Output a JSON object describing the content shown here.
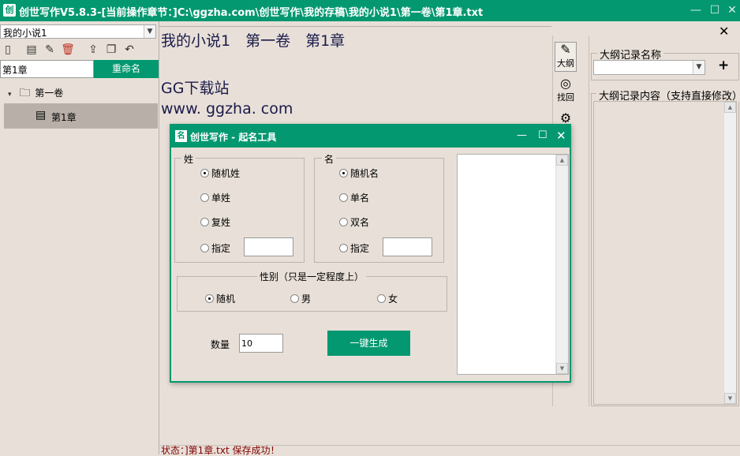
{
  "window": {
    "title": "创世写作V5.8.3-[当前操作章节：]C:\\ggzha.com\\创世写作\\我的存稿\\我的小说1\\第一卷\\第1章.txt",
    "icon_text": "创",
    "minimize": "—",
    "maximize": "☐",
    "close": "✕"
  },
  "sidebar": {
    "novel_select": "我的小说1",
    "rename_input": "第1章",
    "rename_button": "重命名",
    "tree": [
      {
        "label": "第一卷",
        "expanded": true
      },
      {
        "label": "第1章",
        "selected": true
      }
    ],
    "toolbar_icons": [
      "new-book-icon",
      "new-volume-icon",
      "edit-icon",
      "delete-icon",
      "export-icon",
      "copy-icon",
      "undo-icon"
    ]
  },
  "editor": {
    "lines": [
      "我的小说1　第一卷　第1章",
      "",
      "GG下载站",
      "www. ggzha. com"
    ]
  },
  "right_toolbar": {
    "outline_label": "大纲",
    "recover_label": "找回"
  },
  "outline_panel": {
    "close": "✕",
    "name_group": "大纲记录名称",
    "add": "+",
    "content_group": "大纲记录内容（支持直接修改）"
  },
  "dialog": {
    "title": "创世写作 - 起名工具",
    "icon_text": "名",
    "minimize": "—",
    "maximize": "☐",
    "close": "✕",
    "surname": {
      "group": "姓",
      "options": [
        "随机姓",
        "单姓",
        "复姓",
        "指定"
      ],
      "selected": "随机姓",
      "specified_value": ""
    },
    "given": {
      "group": "名",
      "options": [
        "随机名",
        "单名",
        "双名",
        "指定"
      ],
      "selected": "随机名",
      "specified_value": ""
    },
    "gender": {
      "group": "性别（只是一定程度上）",
      "options": [
        "随机",
        "男",
        "女"
      ],
      "selected": "随机"
    },
    "count_label": "数量",
    "count_value": "10",
    "generate_button": "一键生成"
  },
  "status": {
    "text": "状态：]第1章.txt  保存成功！"
  },
  "colors": {
    "accent": "#039870",
    "background": "#e8e0d8",
    "status_text": "#800000",
    "editor_text": "#1a1a4a"
  }
}
